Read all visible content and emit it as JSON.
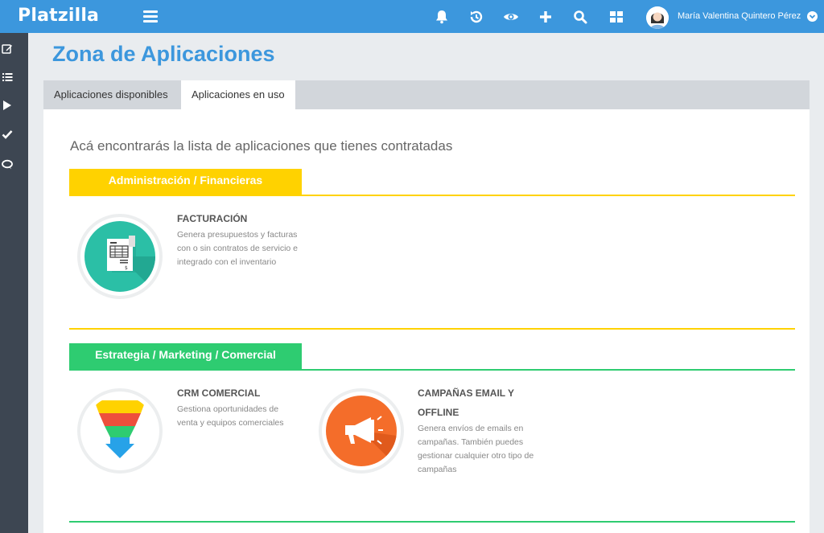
{
  "header": {
    "brand": "Platzilla",
    "user_name": "María Valentina Quintero Pérez",
    "icons": [
      "bell-icon",
      "history-icon",
      "eye-icon",
      "plus-icon",
      "search-icon",
      "grid-icon"
    ]
  },
  "sidebar": {
    "icons": [
      "edit-icon",
      "list-icon",
      "play-icon",
      "check-icon",
      "chat-icon"
    ]
  },
  "page": {
    "title": "Zona de Aplicaciones",
    "tabs": [
      {
        "label": "Aplicaciones disponibles",
        "active": false
      },
      {
        "label": "Aplicaciones en uso",
        "active": true
      }
    ],
    "intro": "Acá encontrarás la lista de aplicaciones que tienes contratadas"
  },
  "sections": [
    {
      "title": "Administración / Financieras",
      "color": "#ffd200",
      "apps": [
        {
          "title": "FACTURACIÓN",
          "description": "Genera presupuestos y facturas con o sin contratos de servicio e integrado con el inventario",
          "icon": "invoice-icon"
        }
      ]
    },
    {
      "title": "Estrategia / Marketing / Comercial",
      "color": "#2ecc71",
      "apps": [
        {
          "title": "CRM COMERCIAL",
          "description": "Gestiona oportunidades de venta y equipos comerciales",
          "icon": "funnel-icon"
        },
        {
          "title": "CAMPAÑAS EMAIL Y OFFLINE",
          "description": "Genera envíos de emails en campañas. También puedes gestionar cualquier otro tipo de campañas",
          "icon": "megaphone-icon"
        }
      ]
    }
  ],
  "colors": {
    "primary": "#3c97dd",
    "sidebar": "#3d4652",
    "invoice_bg": "#2bbfa6",
    "megaphone_bg": "#f46d2a"
  }
}
